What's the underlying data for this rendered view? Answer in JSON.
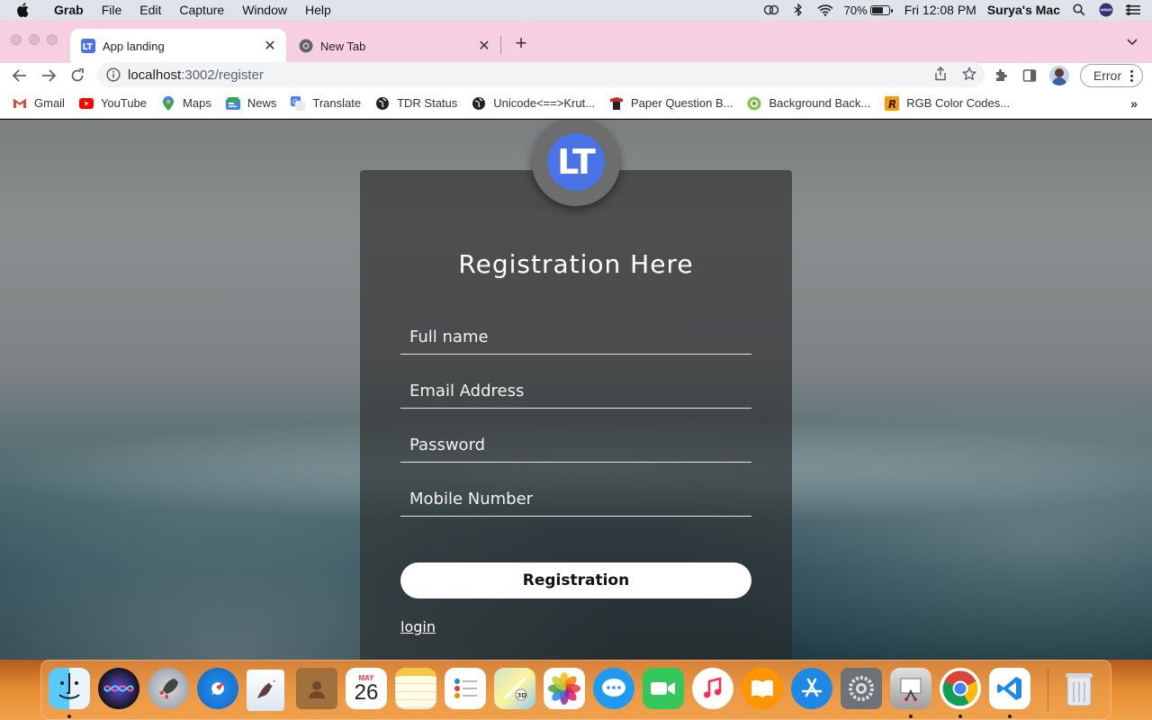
{
  "menubar": {
    "app_name": "Grab",
    "items": [
      "File",
      "Edit",
      "Capture",
      "Window",
      "Help"
    ],
    "battery": "70%",
    "battery_level": 0.7,
    "datetime": "Fri 12:08 PM",
    "user": "Surya's Mac"
  },
  "browser": {
    "tabs": [
      {
        "title": "App landing",
        "icon": "app-favicon-icon",
        "active": true
      },
      {
        "title": "New Tab",
        "icon": "chrome-icon",
        "active": false
      }
    ],
    "url_host": "localhost",
    "url_path": ":3002/register",
    "error_label": "Error"
  },
  "bookmarks": [
    {
      "label": "Gmail",
      "icon": "gmail-icon"
    },
    {
      "label": "YouTube",
      "icon": "youtube-icon"
    },
    {
      "label": "Maps",
      "icon": "maps-icon"
    },
    {
      "label": "News",
      "icon": "news-icon"
    },
    {
      "label": "Translate",
      "icon": "translate-icon"
    },
    {
      "label": "TDR Status",
      "icon": "globe-icon"
    },
    {
      "label": "Unicode<==>Krut...",
      "icon": "globe-icon"
    },
    {
      "label": "Paper Question B...",
      "icon": "paper-icon"
    },
    {
      "label": "Background Back...",
      "icon": "background-icon"
    },
    {
      "label": "RGB Color Codes...",
      "icon": "rgb-icon"
    }
  ],
  "form": {
    "logo_text": "LT",
    "title": "Registration Here",
    "fields": [
      {
        "placeholder": "Full name",
        "value": ""
      },
      {
        "placeholder": "Email Address",
        "value": ""
      },
      {
        "placeholder": "Password",
        "value": ""
      },
      {
        "placeholder": "Mobile Number",
        "value": ""
      }
    ],
    "submit_label": "Registration",
    "login_link": "login"
  },
  "dock": {
    "calendar_month": "MAY",
    "calendar_day": "26",
    "apps": [
      "finder",
      "siri",
      "launchpad",
      "safari",
      "mail",
      "contacts",
      "calendar",
      "notes",
      "reminders",
      "maps",
      "photos",
      "messages",
      "facetime",
      "music",
      "books",
      "app-store",
      "system-preferences",
      "grab",
      "chrome",
      "vscode",
      "trash"
    ]
  },
  "colors": {
    "tabstrip": "#f6d0e0",
    "logo_blue": "#4a73e8",
    "card": "rgba(40,40,40,0.62)"
  }
}
